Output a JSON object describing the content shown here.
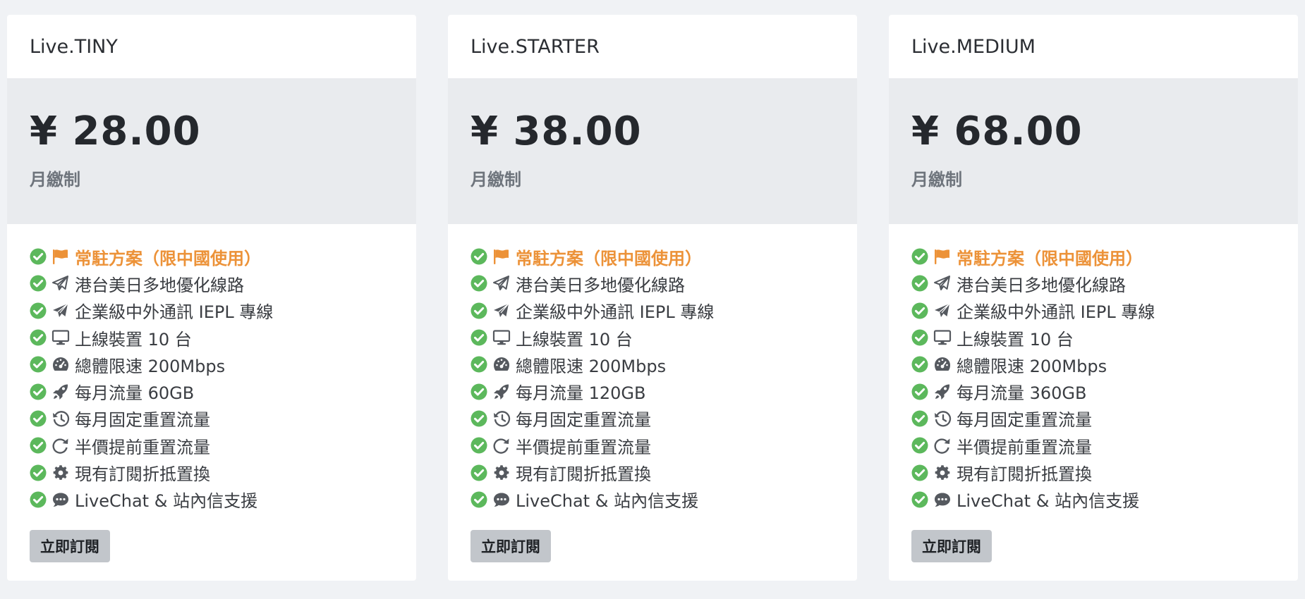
{
  "plans": [
    {
      "name": "Live.TINY",
      "price": "¥ 28.00",
      "billing": "月繳制",
      "features": [
        "常駐方案（限中國使用）",
        "港台美日多地優化線路",
        "企業級中外通訊 IEPL 專線",
        "上線裝置 10 台",
        "總體限速 200Mbps",
        "每月流量 60GB",
        "每月固定重置流量",
        "半價提前重置流量",
        "現有訂閱折抵置換",
        "LiveChat & 站內信支援"
      ],
      "subscribe_label": "立即訂閱"
    },
    {
      "name": "Live.STARTER",
      "price": "¥ 38.00",
      "billing": "月繳制",
      "features": [
        "常駐方案（限中國使用）",
        "港台美日多地優化線路",
        "企業級中外通訊 IEPL 專線",
        "上線裝置 10 台",
        "總體限速 200Mbps",
        "每月流量 120GB",
        "每月固定重置流量",
        "半價提前重置流量",
        "現有訂閱折抵置換",
        "LiveChat & 站內信支援"
      ],
      "subscribe_label": "立即訂閱"
    },
    {
      "name": "Live.MEDIUM",
      "price": "¥ 68.00",
      "billing": "月繳制",
      "features": [
        "常駐方案（限中國使用）",
        "港台美日多地優化線路",
        "企業級中外通訊 IEPL 專線",
        "上線裝置 10 台",
        "總體限速 200Mbps",
        "每月流量 360GB",
        "每月固定重置流量",
        "半價提前重置流量",
        "現有訂閱折抵置換",
        "LiveChat & 站內信支援"
      ],
      "subscribe_label": "立即訂閱"
    }
  ],
  "feature_icons": [
    "flag-icon",
    "paper-plane-outline-icon",
    "paper-plane-icon",
    "desktop-icon",
    "tachometer-icon",
    "rocket-icon",
    "history-icon",
    "redo-icon",
    "gear-icon",
    "comment-dots-icon"
  ],
  "colors": {
    "check": "#5cb85c",
    "highlight": "#ec9238",
    "price_band": "#e9ebee",
    "button": "#c2c6cb"
  }
}
